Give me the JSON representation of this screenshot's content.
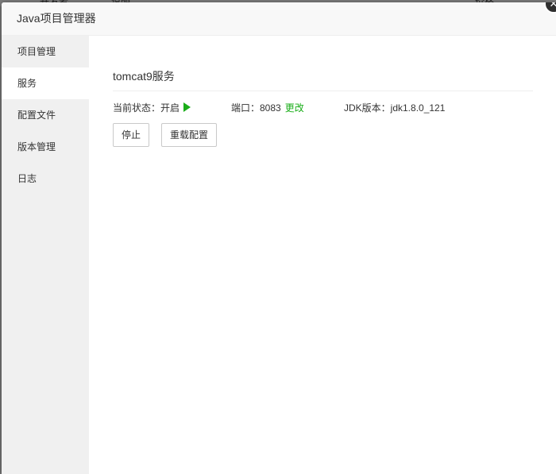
{
  "backdrop": {
    "col1": "开发者",
    "col2": "说明",
    "col3": "价格"
  },
  "dialog": {
    "title": "Java项目管理器",
    "close_icon": "close-icon"
  },
  "sidebar": {
    "items": [
      {
        "label": "项目管理",
        "active": false
      },
      {
        "label": "服务",
        "active": true
      },
      {
        "label": "配置文件",
        "active": false
      },
      {
        "label": "版本管理",
        "active": false
      },
      {
        "label": "日志",
        "active": false
      }
    ]
  },
  "service": {
    "title": "tomcat9服务",
    "status_label": "当前状态：开启",
    "status_icon": "play-icon",
    "status_color": "#1aad19",
    "port_label": "端口：8083",
    "port_change": "更改",
    "jdk_label": "JDK版本：jdk1.8.0_121",
    "stop_button": "停止",
    "reload_button": "重载配置"
  }
}
